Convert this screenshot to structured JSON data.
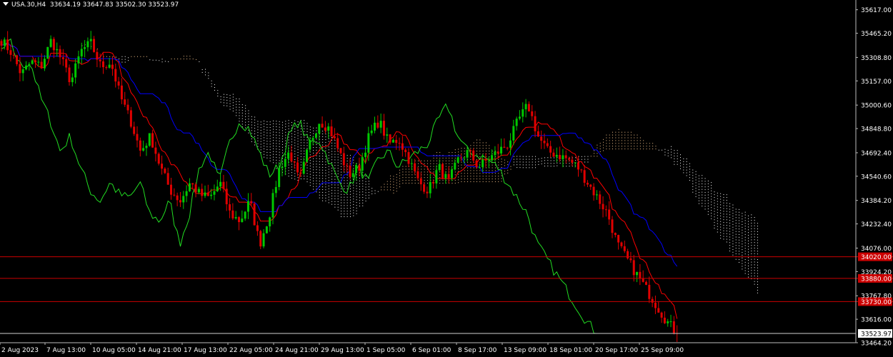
{
  "header": {
    "symbol": "USA.30,H4",
    "ohlc": "33634.19 33647.83 33502.30 33523.97"
  },
  "colors": {
    "background": "#000000",
    "bull": "#00c800",
    "bear": "#e00000",
    "tenkan": "#ff0000",
    "kijun": "#0000ff",
    "chikou": "#22dd22",
    "spanA_dots": "#f4c28a",
    "spanB_dots": "#ffffff",
    "level_line": "#cc0000",
    "level_label_bg": "#cc0000",
    "price_label_bg": "#ffffff"
  },
  "chart_data": {
    "type": "candlestick",
    "indicator": "Ichimoku Kinko Hyo",
    "ylim": [
      33464.2,
      35680
    ],
    "y_ticks": [
      "35617.00",
      "35465.20",
      "35308.80",
      "35157.00",
      "35000.60",
      "34848.80",
      "34692.40",
      "34540.60",
      "34384.20",
      "34232.40",
      "34076.00",
      "33924.20",
      "33767.80",
      "33616.00",
      "33464.20"
    ],
    "x_ticks": [
      "2 Aug 2023",
      "7 Aug 13:00",
      "10 Aug 05:00",
      "14 Aug 21:00",
      "17 Aug 13:00",
      "22 Aug 05:00",
      "24 Aug 21:00",
      "29 Aug 13:00",
      "1 Sep 05:00",
      "6 Sep 01:00",
      "8 Sep 17:00",
      "13 Sep 09:00",
      "18 Sep 01:00",
      "20 Sep 17:00",
      "25 Sep 09:00"
    ],
    "current_price": "33523.97",
    "levels": [
      {
        "label": "34020.00",
        "value": 34020
      },
      {
        "label": "33880.00",
        "value": 33880
      },
      {
        "label": "33730.00",
        "value": 33730
      }
    ],
    "close_path": [
      35420,
      35340,
      35200,
      35280,
      35250,
      35420,
      35300,
      35150,
      35350,
      35400,
      35250,
      35280,
      35050,
      34900,
      34700,
      34800,
      34600,
      34450,
      34380,
      34500,
      34420,
      34400,
      34500,
      34300,
      34250,
      34380,
      34100,
      34300,
      34600,
      34700,
      34500,
      34750,
      34900,
      34850,
      34700,
      34550,
      34600,
      34800,
      34900,
      34750,
      34780,
      34650,
      34500,
      34450,
      34600,
      34500,
      34650,
      34700,
      34600,
      34650,
      34700,
      34750,
      34900,
      35000,
      34800,
      34700,
      34680,
      34650,
      34600,
      34500,
      34400,
      34300,
      34100,
      34000,
      33900,
      33800,
      33700,
      33600,
      33523.97
    ],
    "bull_pct": 50
  }
}
